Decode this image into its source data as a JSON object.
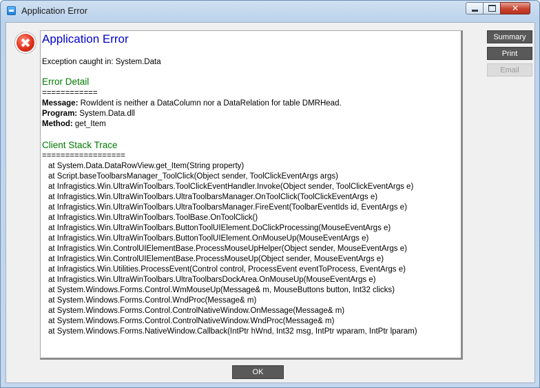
{
  "window": {
    "title": "Application Error",
    "controls": {
      "minimize": "",
      "maximize": "",
      "close": "✕"
    }
  },
  "report": {
    "title": "Application Error",
    "exception_line": "Exception caught in: System.Data",
    "error_detail_heading": "Error Detail",
    "error_detail_rule": "============",
    "message_label": "Message:",
    "message_value": " RowIdent is neither a DataColumn nor a DataRelation for table DMRHead.",
    "program_label": "Program:",
    "program_value": " System.Data.dll",
    "method_label": "Method:",
    "method_value": " get_Item",
    "stack_heading": "Client Stack Trace",
    "stack_rule": "==================",
    "stack_lines": [
      "at System.Data.DataRowView.get_Item(String property)",
      "at Script.baseToolbarsManager_ToolClick(Object sender, ToolClickEventArgs args)",
      "at Infragistics.Win.UltraWinToolbars.ToolClickEventHandler.Invoke(Object sender, ToolClickEventArgs e)",
      "at Infragistics.Win.UltraWinToolbars.UltraToolbarsManager.OnToolClick(ToolClickEventArgs e)",
      "at Infragistics.Win.UltraWinToolbars.UltraToolbarsManager.FireEvent(ToolbarEventIds id, EventArgs e)",
      "at Infragistics.Win.UltraWinToolbars.ToolBase.OnToolClick()",
      "at Infragistics.Win.UltraWinToolbars.ButtonToolUIElement.DoClickProcessing(MouseEventArgs e)",
      "at Infragistics.Win.UltraWinToolbars.ButtonToolUIElement.OnMouseUp(MouseEventArgs e)",
      "at Infragistics.Win.ControlUIElementBase.ProcessMouseUpHelper(Object sender, MouseEventArgs e)",
      "at Infragistics.Win.ControlUIElementBase.ProcessMouseUp(Object sender, MouseEventArgs e)",
      "at Infragistics.Win.Utilities.ProcessEvent(Control control, ProcessEvent eventToProcess, EventArgs e)",
      "at Infragistics.Win.UltraWinToolbars.UltraToolbarsDockArea.OnMouseUp(MouseEventArgs e)",
      "at System.Windows.Forms.Control.WmMouseUp(Message& m, MouseButtons button, Int32 clicks)",
      "at System.Windows.Forms.Control.WndProc(Message& m)",
      "at System.Windows.Forms.Control.ControlNativeWindow.OnMessage(Message& m)",
      "at System.Windows.Forms.Control.ControlNativeWindow.WndProc(Message& m)",
      "at System.Windows.Forms.NativeWindow.Callback(IntPtr hWnd, Int32 msg, IntPtr wparam, IntPtr lparam)"
    ]
  },
  "buttons": {
    "summary": "Summary",
    "print": "Print",
    "email": "Email",
    "ok": "OK"
  },
  "icons": {
    "window_icon": "app-window-icon",
    "error_icon": "error-icon"
  },
  "colors": {
    "title_blue": "#0000c8",
    "heading_green": "#007a00",
    "error_red": "#e0301c"
  }
}
